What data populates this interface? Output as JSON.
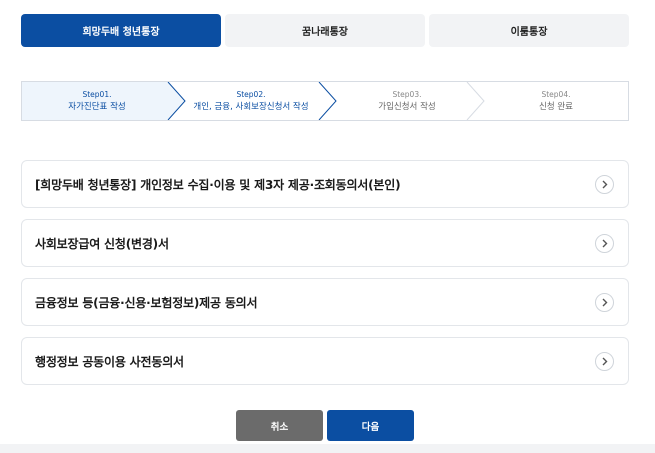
{
  "tabs": [
    {
      "label": "희망두배 청년통장",
      "active": true
    },
    {
      "label": "꿈나래통장",
      "active": false
    },
    {
      "label": "이룸통장",
      "active": false
    }
  ],
  "steps": [
    {
      "num": "Step01.",
      "name": "자가진단표 작성"
    },
    {
      "num": "Step02.",
      "name": "개인, 금융, 사회보장신청서 작성"
    },
    {
      "num": "Step03.",
      "name": "가입신청서 작성"
    },
    {
      "num": "Step04.",
      "name": "신청 완료"
    }
  ],
  "current_step": 2,
  "consents": [
    {
      "title": "[희망두배 청년통장] 개인정보 수집·이용 및 제3자 제공·조회동의서(본인)"
    },
    {
      "title": "사회보장급여 신청(변경)서"
    },
    {
      "title": "금융정보 등(금융·신용·보험정보)제공 동의서"
    },
    {
      "title": "행정정보 공동이용 사전동의서"
    }
  ],
  "buttons": {
    "cancel": "취소",
    "next": "다음"
  },
  "colors": {
    "primary": "#0b4ea2",
    "cancel": "#6b6b6b",
    "tab_inactive": "#f2f3f5"
  },
  "icons": {
    "consent_item": "chevron-right-icon"
  }
}
